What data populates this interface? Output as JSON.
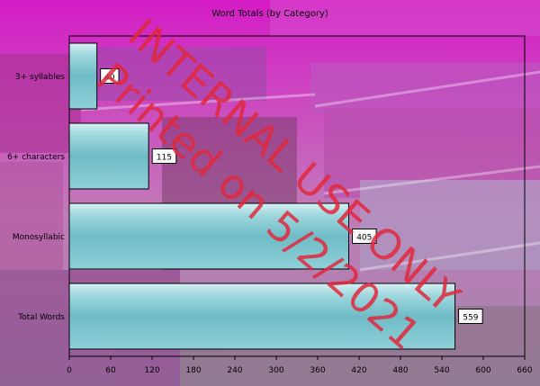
{
  "chart_data": {
    "type": "bar",
    "orientation": "horizontal",
    "title": "Word Totals (by Category)",
    "categories": [
      "Total Words",
      "Monosyllabic",
      "6+ characters",
      "3+ syllables"
    ],
    "values": [
      559,
      405,
      115,
      40
    ],
    "xlim": [
      0,
      660
    ],
    "xticks": [
      0,
      60,
      120,
      180,
      240,
      300,
      360,
      420,
      480,
      540,
      600,
      660
    ],
    "grid": false,
    "legend": "none"
  },
  "watermark": {
    "line1": "INTERNAL USE ONLY",
    "line2": "Printed on 5/2/2021"
  },
  "colors": {
    "bar_fill_top": "#d6f1f4",
    "bar_fill_bottom": "#62b4c0",
    "label_box": "#ffffff",
    "watermark": "#e0283c",
    "background_tint": "#d030c8"
  }
}
